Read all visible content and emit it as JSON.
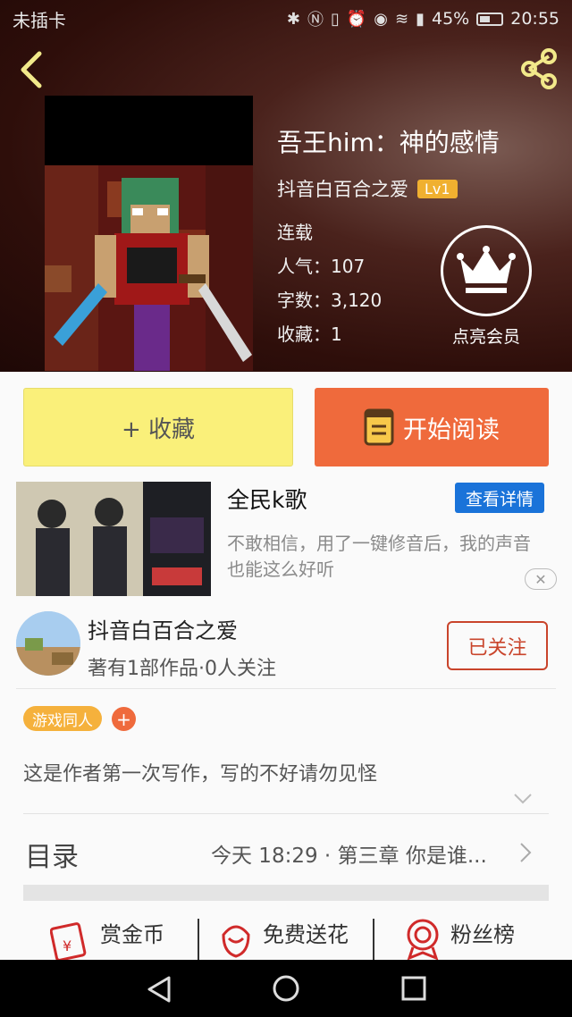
{
  "status_bar": {
    "carrier": "未插卡",
    "battery_percent": "45%",
    "time": "20:55"
  },
  "book": {
    "title": "吾王him：神的感情",
    "author": "抖音白百合之爱",
    "level": "Lv1",
    "status": "连载",
    "popularity": "人气：107",
    "word_count": "字数：3,120",
    "favorites": "收藏：1"
  },
  "vip": {
    "label": "点亮会员"
  },
  "actions": {
    "collect": "+ 收藏",
    "read": "开始阅读"
  },
  "ad": {
    "title": "全民k歌",
    "detail_button": "查看详情",
    "description": "不敢相信，用了一键修音后，我的声音也能这么好听"
  },
  "author_card": {
    "name": "抖音白百合之爱",
    "stats": "著有1部作品·0人关注",
    "follow_button": "已关注"
  },
  "tags": [
    "游戏同人"
  ],
  "intro": "这是作者第一次写作，写的不好请勿见怪",
  "toc": {
    "label": "目录",
    "latest": "今天 18:29 · 第三章 你是谁..."
  },
  "bottom_actions": [
    {
      "label": "赏金币",
      "icon": "reward-icon"
    },
    {
      "label": "免费送花",
      "icon": "flower-icon"
    },
    {
      "label": "粉丝榜",
      "icon": "fans-rank-icon"
    }
  ],
  "colors": {
    "accent_orange": "#ef6a3c",
    "collect_yellow": "#faf07a",
    "level_gold": "#f0b030",
    "ad_blue": "#1a73d9",
    "follow_red": "#c9442b"
  }
}
